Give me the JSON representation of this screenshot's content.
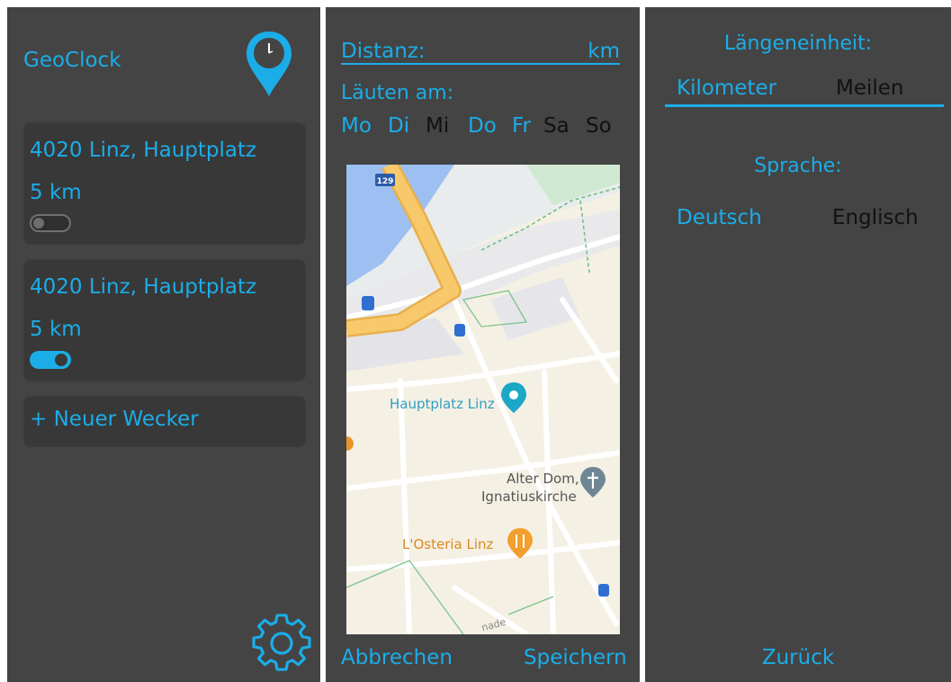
{
  "screen_list": {
    "app_title": "GeoClock",
    "alarms": [
      {
        "address": "4020 Linz, Hauptplatz",
        "distance": "5 km",
        "enabled": false
      },
      {
        "address": "4020 Linz, Hauptplatz",
        "distance": "5 km",
        "enabled": true
      }
    ],
    "new_alarm_label": "+ Neuer Wecker",
    "icons": {
      "logo": "location-clock-pin-icon",
      "settings": "gear-icon"
    }
  },
  "screen_edit": {
    "distance_label": "Distanz:",
    "distance_value": "",
    "distance_unit": "km",
    "ring_on_label": "Läuten am:",
    "days": [
      {
        "label": "Mo",
        "active": true
      },
      {
        "label": "Di",
        "active": true
      },
      {
        "label": "Mi",
        "active": false
      },
      {
        "label": "Do",
        "active": true
      },
      {
        "label": "Fr",
        "active": true
      },
      {
        "label": "Sa",
        "active": false
      },
      {
        "label": "So",
        "active": false
      }
    ],
    "map": {
      "route_shield": "129",
      "pois": [
        {
          "label": "Hauptplatz Linz",
          "icon": "camera-pin-icon"
        },
        {
          "label": "Alter Dom,",
          "label2": "Ignatiuskirche",
          "icon": "church-pin-icon"
        },
        {
          "label": "L'Osteria Linz",
          "icon": "restaurant-pin-icon"
        }
      ],
      "street_fragment": "nade"
    },
    "cancel_label": "Abbrechen",
    "save_label": "Speichern"
  },
  "screen_settings": {
    "unit_heading": "Längeneinheit:",
    "unit_options": [
      {
        "label": "Kilometer",
        "selected": true
      },
      {
        "label": "Meilen",
        "selected": false
      }
    ],
    "language_heading": "Sprache:",
    "language_options": [
      {
        "label": "Deutsch",
        "selected": true
      },
      {
        "label": "Englisch",
        "selected": false
      }
    ],
    "back_label": "Zurück"
  },
  "colors": {
    "accent": "#1BADE8",
    "panel_bg": "#444444",
    "card_bg": "#383838",
    "inactive_text": "#111111",
    "map_bg": "#F5F0E4",
    "map_road": "#F7C96B",
    "map_water": "#9DBFF2"
  }
}
